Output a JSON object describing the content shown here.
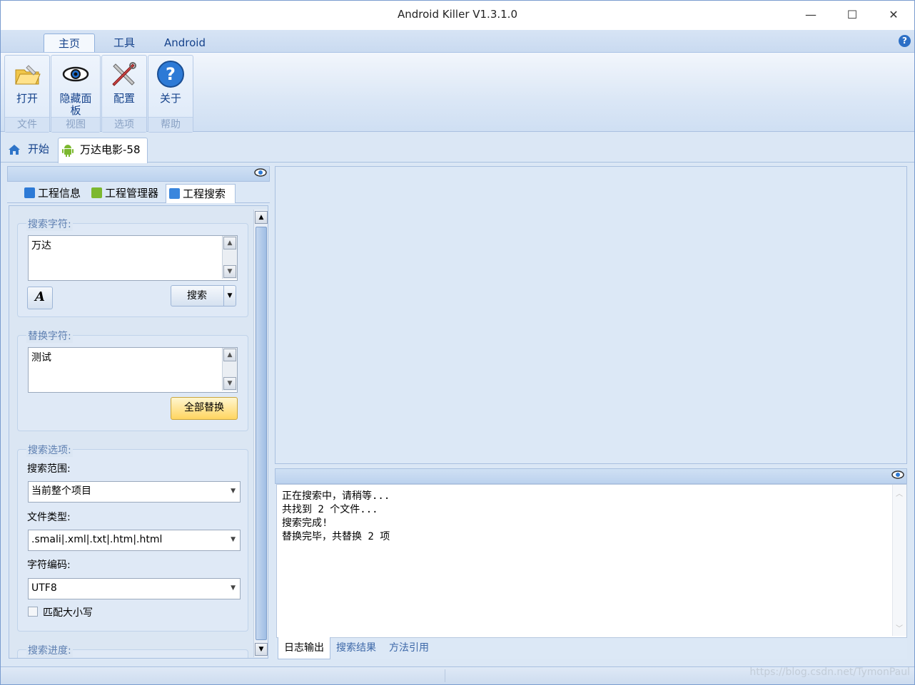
{
  "window": {
    "title": "Android Killer V1.3.1.0",
    "minimize": "—",
    "maximize": "☐",
    "close": "✕"
  },
  "menu": {
    "tabs": [
      {
        "label": "主页"
      },
      {
        "label": "工具"
      },
      {
        "label": "Android"
      }
    ],
    "help": "?"
  },
  "ribbon": {
    "groups": [
      {
        "caption": "文件",
        "button": "打开",
        "icon": "open-folder-icon"
      },
      {
        "caption": "视图",
        "button": "隐藏面板",
        "icon": "eye-icon"
      },
      {
        "caption": "选项",
        "button": "配置",
        "icon": "tools-icon"
      },
      {
        "caption": "帮助",
        "button": "关于",
        "icon": "help-icon"
      }
    ]
  },
  "doc_tabs": [
    {
      "label": "开始",
      "icon": "home-icon"
    },
    {
      "label": "万达电影-58",
      "icon": "android-icon"
    }
  ],
  "left_panel": {
    "tabs": [
      {
        "label": "工程信息"
      },
      {
        "label": "工程管理器"
      },
      {
        "label": "工程搜索"
      }
    ],
    "search": {
      "label": "搜索字符:",
      "value": "万达",
      "button": "搜索",
      "font_button": "A"
    },
    "replace": {
      "label": "替换字符:",
      "value": "测试",
      "button": "全部替换"
    },
    "options": {
      "label": "搜索选项:",
      "scope_label": "搜索范围:",
      "scope_value": "当前整个项目",
      "filetype_label": "文件类型:",
      "filetype_value": ".smali|.xml|.txt|.htm|.html",
      "encoding_label": "字符编码:",
      "encoding_value": "UTF8",
      "match_case": "匹配大小写",
      "match_case_checked": false
    },
    "progress": {
      "label": "搜索进度:"
    }
  },
  "log": {
    "lines": [
      "正在搜索中，请稍等...",
      "共找到 2 个文件...",
      "搜索完成!",
      "替换完毕，共替换 2 项"
    ]
  },
  "bottom_tabs": [
    {
      "label": "日志输出"
    },
    {
      "label": "搜索结果"
    },
    {
      "label": "方法引用"
    }
  ],
  "watermark": "https://blog.csdn.net/TymonPaul",
  "colors": {
    "accent": "#15428b",
    "panel": "#dce8f6",
    "gold": "#ffd560"
  }
}
